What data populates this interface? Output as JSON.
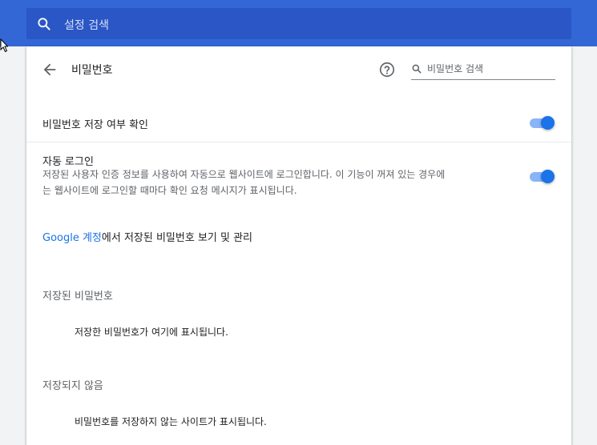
{
  "header": {
    "search_placeholder": "설정 검색"
  },
  "subpage": {
    "title": "비밀번호",
    "search_placeholder": "비밀번호 검색"
  },
  "settings": {
    "offer_to_save": {
      "label": "비밀번호 저장 여부 확인",
      "enabled": true
    },
    "auto_signin": {
      "label": "자동 로그인",
      "description_line1": "저장된 사용자 인증 정보를 사용하여 자동으로 웹사이트에 로그인합니다. 이 기능이 꺼져 있는 경우에",
      "description_line2": "는 웹사이트에 로그인할 때마다 확인 요청 메시지가 표시됩니다.",
      "enabled": true
    }
  },
  "account_link": {
    "link_text": "Google 계정",
    "rest_text": "에서 저장된 비밀번호 보기 및 관리"
  },
  "saved_passwords": {
    "heading": "저장된 비밀번호",
    "empty_message": "저장한 비밀번호가 여기에 표시됩니다."
  },
  "never_saved": {
    "heading": "저장되지 않음",
    "empty_message": "비밀번호를 저장하지 않는 사이트가 표시됩니다."
  },
  "colors": {
    "header_bg": "#3367d6",
    "search_bg": "#2a56c6",
    "accent": "#1a73e8",
    "toggle_track": "#8ab4f8"
  }
}
